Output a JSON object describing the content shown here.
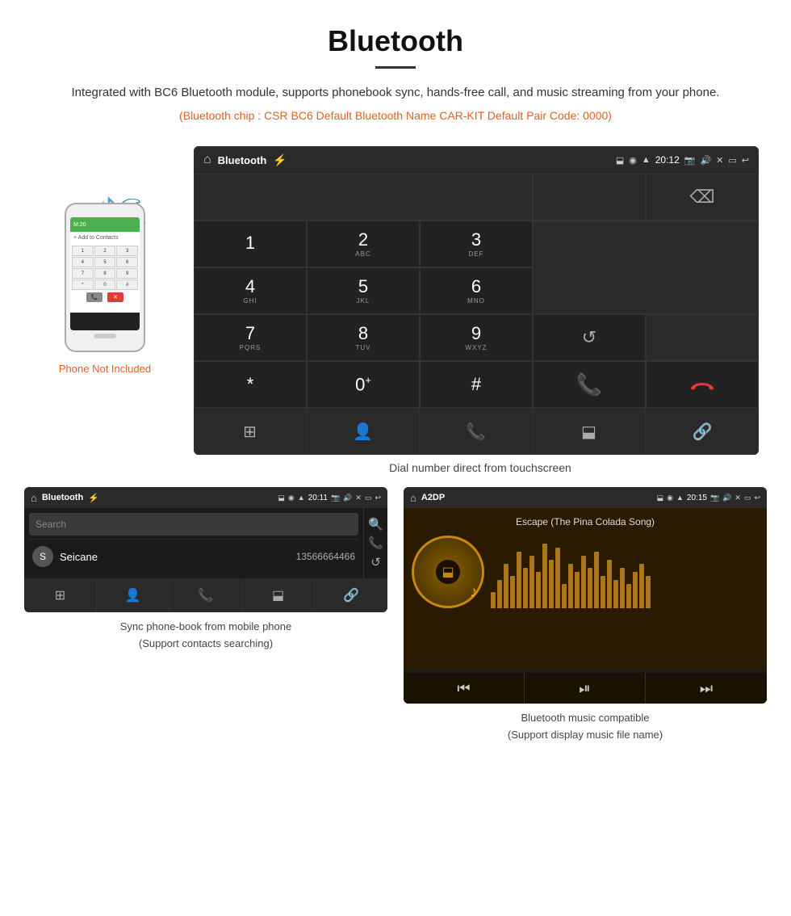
{
  "header": {
    "title": "Bluetooth",
    "subtitle": "Integrated with BC6 Bluetooth module, supports phonebook sync, hands-free call, and music streaming from your phone.",
    "specs": "(Bluetooth chip : CSR BC6    Default Bluetooth Name CAR-KIT    Default Pair Code: 0000)"
  },
  "phone_label": "Phone Not Included",
  "dial_screen": {
    "status_bar": {
      "app_name": "Bluetooth",
      "time": "20:12"
    },
    "keys": [
      {
        "main": "1",
        "sub": ""
      },
      {
        "main": "2",
        "sub": "ABC"
      },
      {
        "main": "3",
        "sub": "DEF"
      },
      {
        "main": "4",
        "sub": "GHI"
      },
      {
        "main": "5",
        "sub": "JKL"
      },
      {
        "main": "6",
        "sub": "MNO"
      },
      {
        "main": "7",
        "sub": "PQRS"
      },
      {
        "main": "8",
        "sub": "TUV"
      },
      {
        "main": "9",
        "sub": "WXYZ"
      },
      {
        "main": "*",
        "sub": ""
      },
      {
        "main": "0⁺",
        "sub": ""
      },
      {
        "main": "#",
        "sub": ""
      }
    ],
    "caption": "Dial number direct from touchscreen"
  },
  "phonebook_screen": {
    "status_bar": {
      "app_name": "Bluetooth",
      "time": "20:11"
    },
    "search_placeholder": "Search",
    "contact": {
      "initial": "S",
      "name": "Seicane",
      "number": "13566664466"
    },
    "caption_line1": "Sync phone-book from mobile phone",
    "caption_line2": "(Support contacts searching)"
  },
  "music_screen": {
    "status_bar": {
      "app_name": "A2DP",
      "time": "20:15"
    },
    "song_title": "Escape (The Pina Colada Song)",
    "caption_line1": "Bluetooth music compatible",
    "caption_line2": "(Support display music file name)"
  },
  "eq_bars": [
    20,
    35,
    55,
    40,
    70,
    50,
    65,
    45,
    80,
    60,
    75,
    30,
    55,
    45,
    65,
    50,
    70,
    40,
    60,
    35,
    50,
    30,
    45,
    55,
    40
  ]
}
